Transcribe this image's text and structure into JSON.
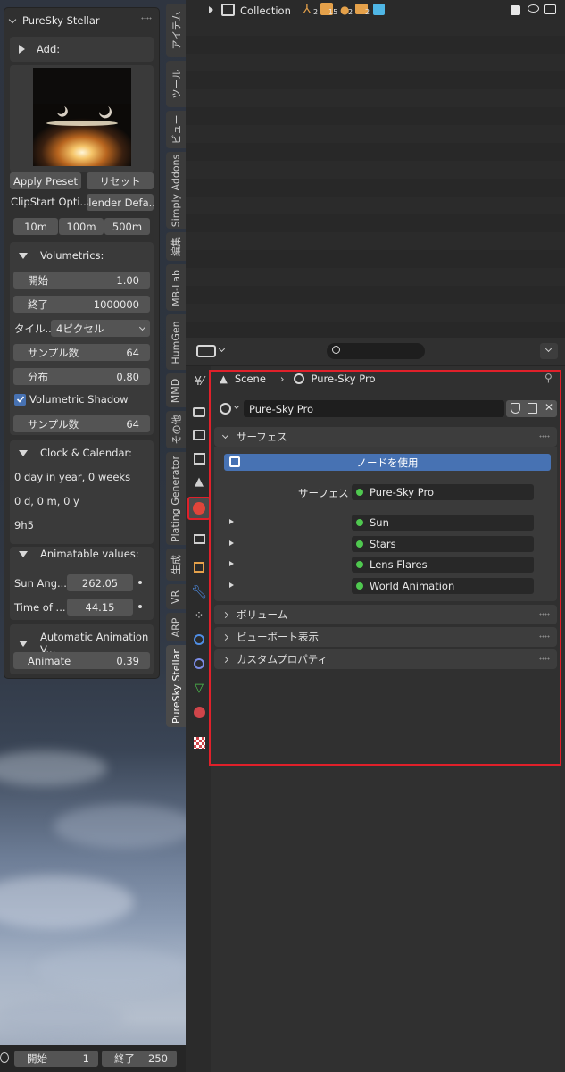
{
  "npanel": {
    "title": "PureSky Stellar",
    "add_label": "Add:",
    "apply_preset": "Apply Preset",
    "reset": "リセット",
    "clipstart": "ClipStart Opti...",
    "blender_default": "Blender Defa...",
    "distances": [
      "10m",
      "100m",
      "500m"
    ],
    "volumetrics": {
      "label": "Volumetrics:",
      "start_label": "開始",
      "start_value": "1.00",
      "end_label": "終了",
      "end_value": "1000000",
      "tile_label": "タイル...",
      "tile_value": "4ピクセル",
      "samples_label": "サンプル数",
      "samples_value": "64",
      "distribution_label": "分布",
      "distribution_value": "0.80",
      "shadow_label": "Volumetric Shadow",
      "shadow_checked": true,
      "shadow_samples_label": "サンプル数",
      "shadow_samples_value": "64"
    },
    "clock": {
      "label": "Clock & Calendar:",
      "line1": "0 day in year, 0 weeks",
      "line2": "0 d, 0 m, 0 y",
      "line3": "9h5"
    },
    "animatable": {
      "label": "Animatable values:",
      "sun_angle_label": "Sun Ang...",
      "sun_angle_value": "262.05",
      "time_label": "Time of ...",
      "time_value": "44.15"
    },
    "auto_anim": {
      "label": "Automatic Animation V...",
      "animate_label": "Animate",
      "animate_value": "0.39"
    }
  },
  "side_tabs": [
    "アイテム",
    "ツール",
    "ビュー",
    "Simply Addons",
    "編集",
    "MB-Lab",
    "HumGen",
    "MMD",
    "その他",
    "Plating Generator",
    "生成",
    "VR",
    "ARP",
    "PureSky Stellar"
  ],
  "outliner": {
    "collection_label": "Collection",
    "badge_counts": [
      "2",
      "15",
      "2",
      "2"
    ]
  },
  "properties": {
    "breadcrumb_scene": "Scene",
    "breadcrumb_world": "Pure-Sky Pro",
    "world_name": "Pure-Sky Pro",
    "surface_header": "サーフェス",
    "use_nodes": "ノードを使用",
    "surface_label": "サーフェス",
    "surface_value": "Pure-Sky Pro",
    "inputs": [
      "Sun",
      "Stars",
      "Lens Flares",
      "World Animation"
    ],
    "volume_header": "ボリューム",
    "viewport_header": "ビューポート表示",
    "custom_header": "カスタムプロパティ"
  },
  "timeline": {
    "start_label": "開始",
    "start_value": "1",
    "end_label": "終了",
    "end_value": "250"
  },
  "colors": {
    "accent": "#4772b3",
    "highlight_box": "#e0202a",
    "socket": "#4fc84f"
  }
}
